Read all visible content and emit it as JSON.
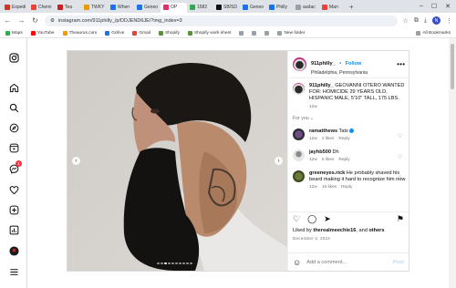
{
  "browser": {
    "tabs": [
      {
        "label": "Expedi",
        "color": "#d93025"
      },
      {
        "label": "Chemi",
        "color": "#ea4335"
      },
      {
        "label": "Tea",
        "color": "#c5221f"
      },
      {
        "label": "TWKY",
        "color": "#f29900"
      },
      {
        "label": "When",
        "color": "#1a73e8"
      },
      {
        "label": "Geneo",
        "color": "#1a73e8"
      },
      {
        "label": "OP",
        "color": "#e1306c",
        "active": true
      },
      {
        "label": "1582",
        "color": "#34a853"
      },
      {
        "label": "SB/SD",
        "color": "#111111"
      },
      {
        "label": "Geneo",
        "color": "#1a73e8"
      },
      {
        "label": "Philly",
        "color": "#1a73e8"
      },
      {
        "label": "audac",
        "color": "#9aa0a6"
      },
      {
        "label": "Man",
        "color": "#ea4335"
      }
    ],
    "tab_plus": "+",
    "url": "instagram.com/911philly_/p/DDJEND6JE/?img_index=3",
    "profile_initial": "N",
    "bookmarks": [
      {
        "label": "Maps",
        "color": "#34a853"
      },
      {
        "label": "YouTube",
        "color": "#ff0000"
      },
      {
        "label": "Theaurus.com",
        "color": "#f29900"
      },
      {
        "label": "Gdrive",
        "color": "#1a73e8"
      },
      {
        "label": "Gmail",
        "color": "#ea4335"
      },
      {
        "label": "Shopify",
        "color": "#5e8e3e"
      },
      {
        "label": "Shopify work sheet",
        "color": "#5e8e3e"
      },
      {
        "label": "",
        "color": "#9aa0a6"
      },
      {
        "label": "",
        "color": "#9aa0a6"
      },
      {
        "label": "",
        "color": "#9aa0a6"
      },
      {
        "label": "New folder",
        "color": "#9aa0a6"
      }
    ],
    "all_bookmarks": "All Bookmarks"
  },
  "sidebar": {
    "icons": [
      "instagram-icon",
      "home-icon",
      "search-icon",
      "explore-icon",
      "reels-icon",
      "messages-icon",
      "notifications-icon",
      "create-icon",
      "dashboard-icon",
      "profile-icon",
      "menu-icon"
    ],
    "messages_badge": "1"
  },
  "post": {
    "username": "911philly_",
    "follow_sep": "•",
    "follow_label": "Follow",
    "location": "Philadelphia, Pennsylvania",
    "caption_user": "911philly_",
    "caption": "GEOVANNI OTERO WANTED FOR: HOMICIDE 29 YEARS OLD, HISPANIC MALE, 5'10\" TALL, 175 LBS.",
    "caption_time": "12w",
    "for_you": "For you",
    "comments": [
      {
        "user": "ramatthews",
        "text": "Tats",
        "time": "12w",
        "likes": "2 likes",
        "reply": "Reply",
        "verified": true
      },
      {
        "user": "jayhb500",
        "text": "Dh",
        "time": "12w",
        "likes": "5 likes",
        "reply": "Reply",
        "verified": false
      },
      {
        "user": "greeneyes.rick",
        "text": "He probably shaved his beard making it hard to recognize him now",
        "time": "12w",
        "likes": "16 likes",
        "reply": "Reply",
        "verified": false
      }
    ],
    "liked_prefix": "Liked by ",
    "liked_user": "therealmeechie16",
    "liked_mid": "and",
    "liked_others": "others",
    "date": "December 4, 2024",
    "add_comment_placeholder": "Add a comment...",
    "post_label": "Post",
    "image_count": 10,
    "image_active": 2
  }
}
